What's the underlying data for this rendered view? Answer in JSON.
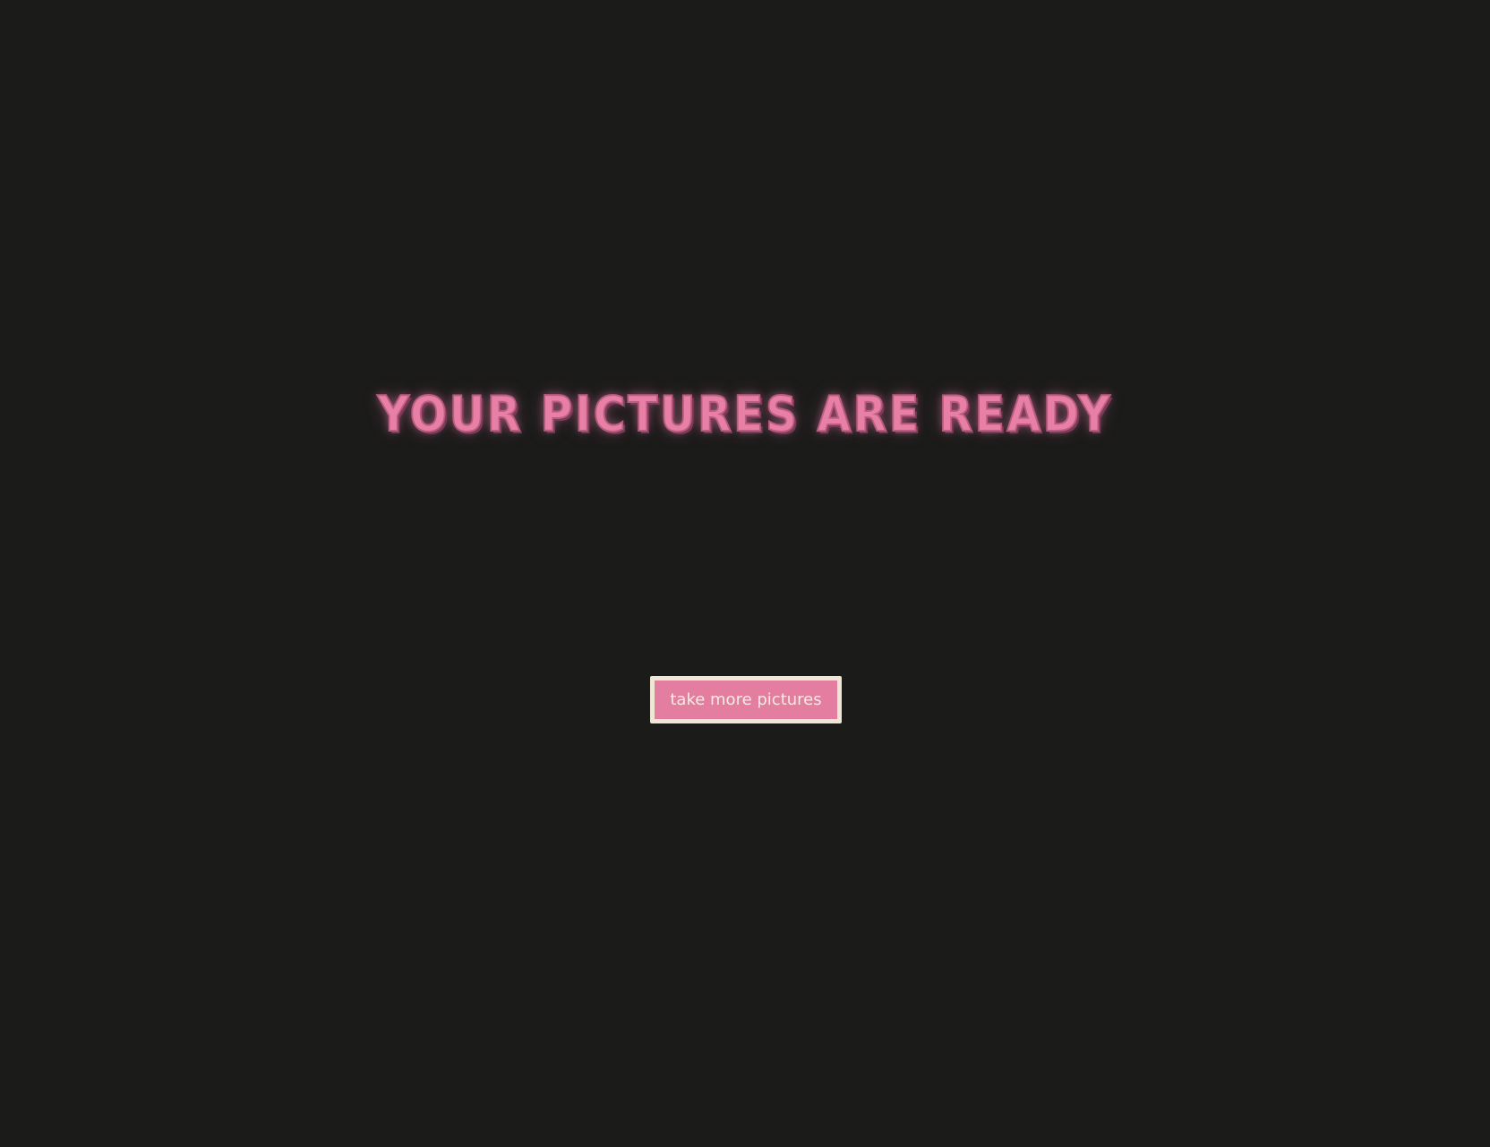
{
  "page": {
    "title": "YOUR PICTURES ARE READY"
  },
  "actions": {
    "take_more_label": "take more pictures"
  },
  "colors": {
    "background": "#1b1b1a",
    "accent_pink": "#e87fa5",
    "button_fill": "#e47ea1",
    "button_border": "#efe6d6",
    "button_text": "#f4ece2"
  }
}
